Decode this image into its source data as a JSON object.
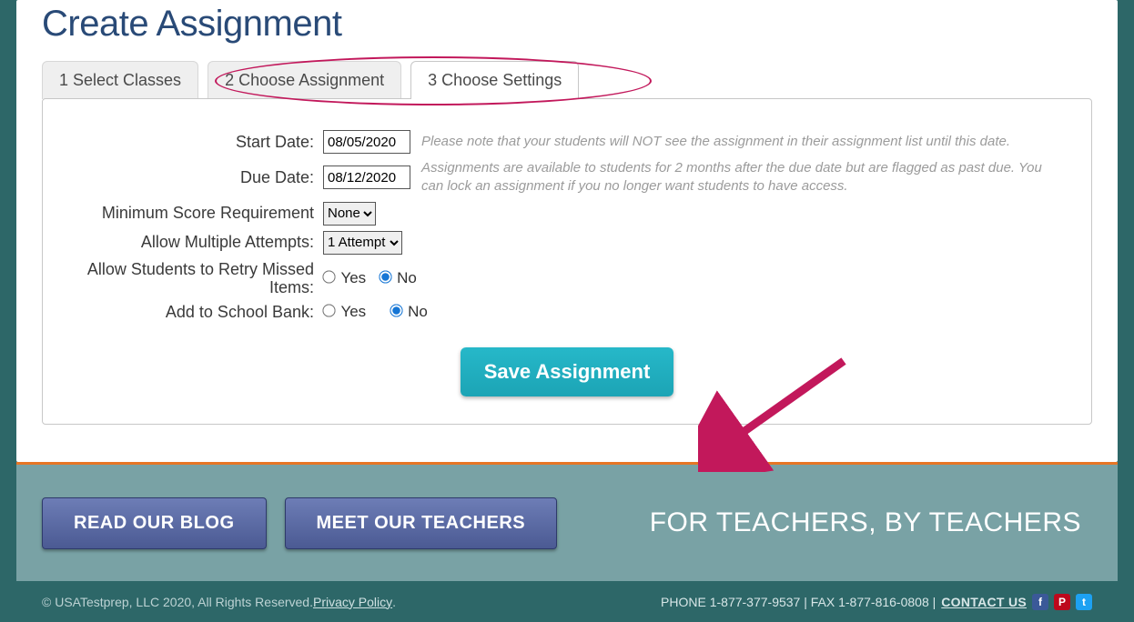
{
  "page": {
    "title": "Create Assignment",
    "tabs": [
      {
        "label": "1 Select Classes"
      },
      {
        "label": "2 Choose Assignment"
      },
      {
        "label": "3 Choose Settings"
      }
    ]
  },
  "settings": {
    "start_date": {
      "label": "Start Date:",
      "value": "08/05/2020",
      "hint": "Please note that your students will NOT see the assignment in their assignment list until this date."
    },
    "due_date": {
      "label": "Due Date:",
      "value": "08/12/2020",
      "hint": "Assignments are available to students for 2 months after the due date but are flagged as past due. You can lock an assignment if you no longer want students to have access."
    },
    "min_score": {
      "label": "Minimum Score Requirement",
      "selected": "None"
    },
    "attempts": {
      "label": "Allow Multiple Attempts:",
      "selected": "1 Attempt"
    },
    "retry": {
      "label": "Allow Students to Retry Missed Items:",
      "yes": "Yes",
      "no": "No",
      "value": "No"
    },
    "bank": {
      "label": "Add to School Bank:",
      "yes": "Yes",
      "no": "No",
      "value": "No"
    },
    "save_label": "Save Assignment"
  },
  "footer": {
    "blog_label": "READ OUR BLOG",
    "teachers_label": "MEET OUR TEACHERS",
    "tagline": "FOR TEACHERS, BY TEACHERS"
  },
  "bottom": {
    "copyright": "© USATestprep, LLC 2020, All Rights Reserved. ",
    "privacy_label": "Privacy Policy",
    "suffix": ".",
    "phone_fax": "PHONE 1-877-377-9537 | FAX 1-877-816-0808 | ",
    "contact_label": "CONTACT US"
  },
  "icons": {
    "facebook": "f",
    "pinterest": "P",
    "twitter": "t"
  }
}
